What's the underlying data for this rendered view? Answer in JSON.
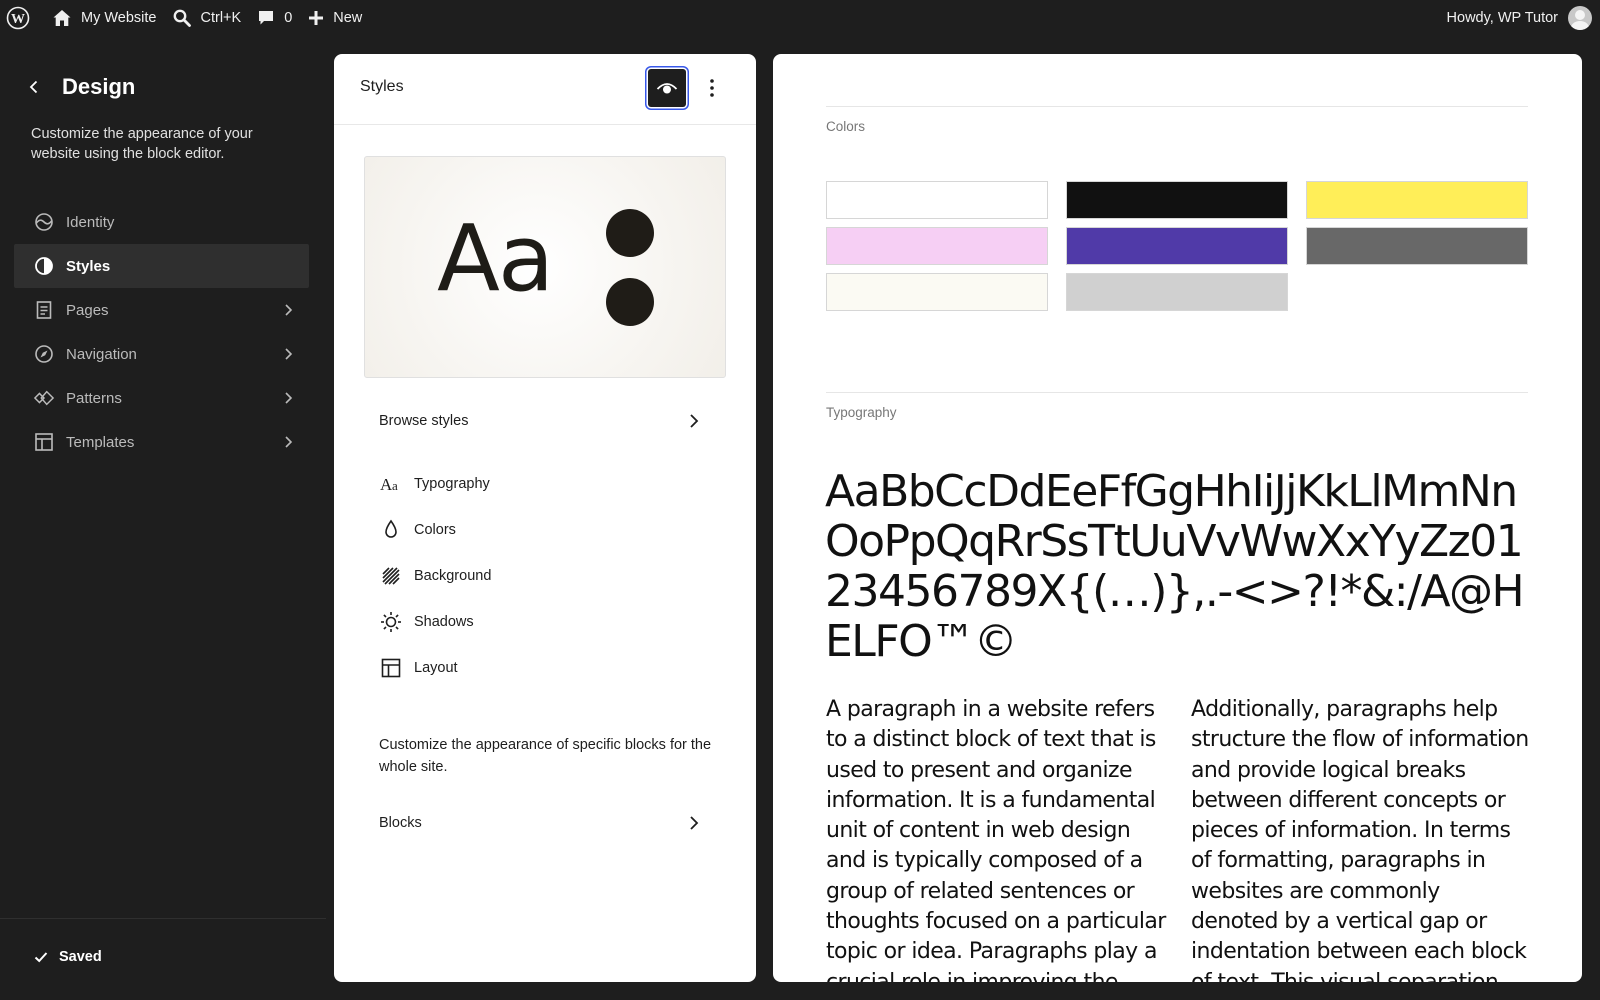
{
  "adminbar": {
    "logo_icon": "wordpress-icon",
    "site_name": "My Website",
    "search_shortcut": "Ctrl+K",
    "comments_count": "0",
    "new_label": "New",
    "greeting": "Howdy, WP Tutor"
  },
  "sidebar": {
    "title": "Design",
    "description": "Customize the appearance of your website using the block editor.",
    "items": [
      {
        "label": "Identity",
        "icon": "identity-icon",
        "active": false,
        "chevron": false
      },
      {
        "label": "Styles",
        "icon": "contrast-icon",
        "active": true,
        "chevron": false
      },
      {
        "label": "Pages",
        "icon": "page-icon",
        "active": false,
        "chevron": true
      },
      {
        "label": "Navigation",
        "icon": "compass-icon",
        "active": false,
        "chevron": true
      },
      {
        "label": "Patterns",
        "icon": "pattern-icon",
        "active": false,
        "chevron": true
      },
      {
        "label": "Templates",
        "icon": "layout-icon",
        "active": false,
        "chevron": true
      }
    ],
    "status": "Saved"
  },
  "styles_panel": {
    "title": "Styles",
    "preview_text": "Aa",
    "browse_label": "Browse styles",
    "options": [
      {
        "label": "Typography",
        "icon": "typography-icon"
      },
      {
        "label": "Colors",
        "icon": "color-drop-icon"
      },
      {
        "label": "Background",
        "icon": "background-icon"
      },
      {
        "label": "Shadows",
        "icon": "shadow-icon"
      },
      {
        "label": "Layout",
        "icon": "layout-icon"
      }
    ],
    "blocks_description": "Customize the appearance of specific blocks for the whole site.",
    "blocks_label": "Blocks"
  },
  "canvas": {
    "colors_label": "Colors",
    "palette": [
      "#ffffff",
      "#111111",
      "#ffee58",
      "#f6cff4",
      "#503aa8",
      "#686868",
      "#fbfaf3",
      "#d0d0d0"
    ],
    "typography_label": "Typography",
    "specimen": "AaBbCcDdEeFfGgHhIiJjKkLlMmNnOoPpQqRrSsTtUuVvWwXxYyZz0123456789X{(…)},.-<>?!*&:/A@HELFO™©",
    "paragraph_1": "A paragraph in a website refers to a distinct block of text that is used to present and organize information. It is a fundamental unit of content in web design and is typically composed of a group of related sentences or thoughts focused on a particular topic or idea. Paragraphs play a crucial role in improving the readability and",
    "paragraph_2": "Additionally, paragraphs help structure the flow of information and provide logical breaks between different concepts or pieces of information. In terms of formatting, paragraphs in websites are commonly denoted by a vertical gap or indentation between each block of text. This visual separation helps visually"
  }
}
